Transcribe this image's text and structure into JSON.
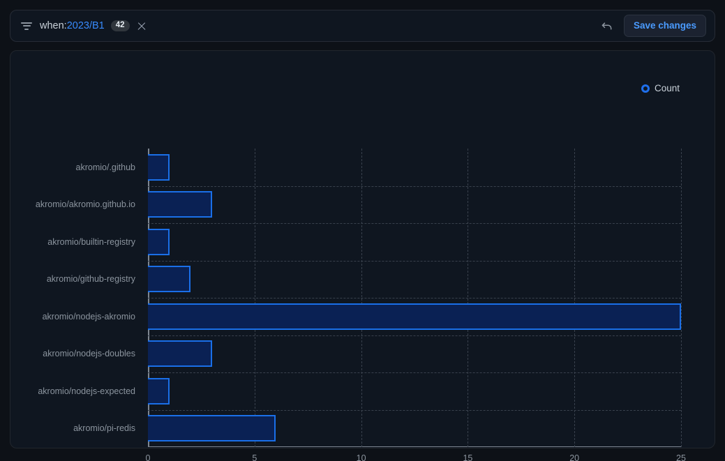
{
  "filter": {
    "icon": "filter-icon",
    "key": "when:",
    "value": "2023/B1",
    "count_badge": "42",
    "close_icon": "close-icon",
    "undo_icon": "undo-arrow-icon",
    "save_label": "Save changes"
  },
  "colors": {
    "page_bg": "#0d1117",
    "panel_bg": "#0f1620",
    "accent_blue": "#388bfd",
    "bar_fill": "#0a2154",
    "bar_stroke": "#1a6fe8",
    "grid": "#39414d",
    "axis": "#7d8590",
    "text_muted": "#8b949e"
  },
  "chart_data": {
    "type": "bar",
    "orientation": "horizontal",
    "title": "",
    "xlabel": "",
    "ylabel": "",
    "legend": [
      {
        "name": "Count",
        "color": "#1f6feb",
        "marker": "ring"
      }
    ],
    "legend_position": "top-right",
    "grid": true,
    "xlim": [
      0,
      25
    ],
    "xticks": [
      "0",
      "5",
      "10",
      "15",
      "20",
      "25"
    ],
    "xtick_values": [
      0,
      5,
      10,
      15,
      20,
      25
    ],
    "categories": [
      "akromio/.github",
      "akromio/akromio.github.io",
      "akromio/builtin-registry",
      "akromio/github-registry",
      "akromio/nodejs-akromio",
      "akromio/nodejs-doubles",
      "akromio/nodejs-expected",
      "akromio/pi-redis"
    ],
    "series": [
      {
        "name": "Count",
        "values": [
          1,
          3,
          1,
          2,
          25,
          3,
          1,
          6
        ]
      }
    ]
  }
}
